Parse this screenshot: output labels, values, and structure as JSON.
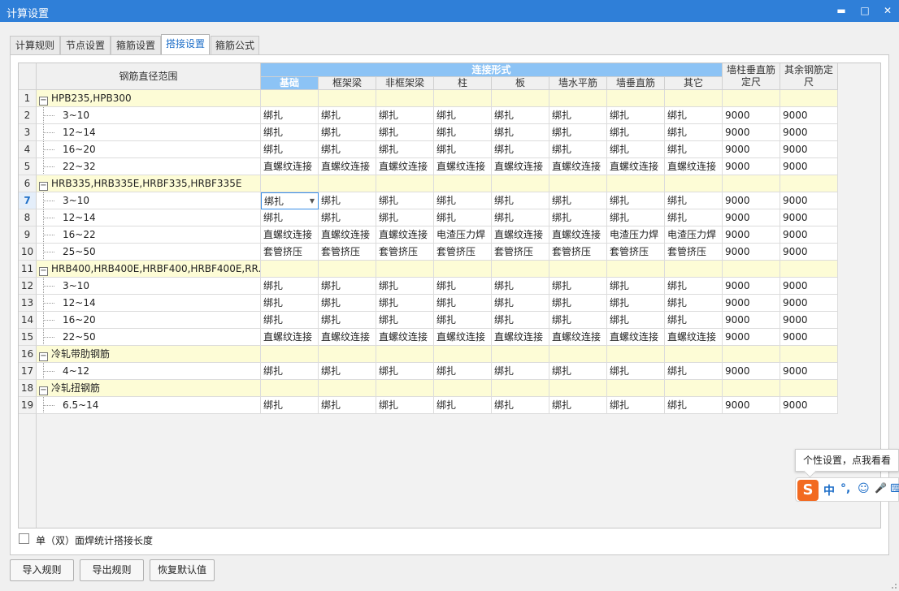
{
  "window": {
    "title": "计算设置",
    "minimize": "▬",
    "maximize": "□",
    "close": "✕"
  },
  "tabs": [
    {
      "label": "计算规则"
    },
    {
      "label": "节点设置"
    },
    {
      "label": "箍筋设置"
    },
    {
      "label": "搭接设置",
      "active": true
    },
    {
      "label": "箍筋公式"
    }
  ],
  "table": {
    "headers": {
      "range": "钢筋直径范围",
      "connect_group": "连接形式",
      "columns": [
        "基础",
        "框架梁",
        "非框架梁",
        "柱",
        "板",
        "墙水平筋",
        "墙垂直筋",
        "其它"
      ],
      "wall_col_len": "墙柱垂直筋定尺",
      "other_len": "其余钢筋定尺"
    },
    "rows": [
      {
        "n": "1",
        "group": true,
        "label": "HPB235,HPB300"
      },
      {
        "n": "2",
        "label": "3~10",
        "c": [
          "绑扎",
          "绑扎",
          "绑扎",
          "绑扎",
          "绑扎",
          "绑扎",
          "绑扎",
          "绑扎"
        ],
        "l1": "9000",
        "l2": "9000"
      },
      {
        "n": "3",
        "label": "12~14",
        "c": [
          "绑扎",
          "绑扎",
          "绑扎",
          "绑扎",
          "绑扎",
          "绑扎",
          "绑扎",
          "绑扎"
        ],
        "l1": "9000",
        "l2": "9000"
      },
      {
        "n": "4",
        "label": "16~20",
        "c": [
          "绑扎",
          "绑扎",
          "绑扎",
          "绑扎",
          "绑扎",
          "绑扎",
          "绑扎",
          "绑扎"
        ],
        "l1": "9000",
        "l2": "9000"
      },
      {
        "n": "5",
        "label": "22~32",
        "c": [
          "直螺纹连接",
          "直螺纹连接",
          "直螺纹连接",
          "直螺纹连接",
          "直螺纹连接",
          "直螺纹连接",
          "直螺纹连接",
          "直螺纹连接"
        ],
        "l1": "9000",
        "l2": "9000"
      },
      {
        "n": "6",
        "group": true,
        "label": "HRB335,HRB335E,HRBF335,HRBF335E"
      },
      {
        "n": "7",
        "label": "3~10",
        "selected": true,
        "c": [
          "绑扎",
          "绑扎",
          "绑扎",
          "绑扎",
          "绑扎",
          "绑扎",
          "绑扎",
          "绑扎"
        ],
        "l1": "9000",
        "l2": "9000"
      },
      {
        "n": "8",
        "label": "12~14",
        "c": [
          "绑扎",
          "绑扎",
          "绑扎",
          "绑扎",
          "绑扎",
          "绑扎",
          "绑扎",
          "绑扎"
        ],
        "l1": "9000",
        "l2": "9000"
      },
      {
        "n": "9",
        "label": "16~22",
        "c": [
          "直螺纹连接",
          "直螺纹连接",
          "直螺纹连接",
          "电渣压力焊",
          "直螺纹连接",
          "直螺纹连接",
          "电渣压力焊",
          "电渣压力焊"
        ],
        "l1": "9000",
        "l2": "9000"
      },
      {
        "n": "10",
        "label": "25~50",
        "c": [
          "套管挤压",
          "套管挤压",
          "套管挤压",
          "套管挤压",
          "套管挤压",
          "套管挤压",
          "套管挤压",
          "套管挤压"
        ],
        "l1": "9000",
        "l2": "9000"
      },
      {
        "n": "11",
        "group": true,
        "label": "HRB400,HRB400E,HRBF400,HRBF400E,RR..."
      },
      {
        "n": "12",
        "label": "3~10",
        "c": [
          "绑扎",
          "绑扎",
          "绑扎",
          "绑扎",
          "绑扎",
          "绑扎",
          "绑扎",
          "绑扎"
        ],
        "l1": "9000",
        "l2": "9000"
      },
      {
        "n": "13",
        "label": "12~14",
        "c": [
          "绑扎",
          "绑扎",
          "绑扎",
          "绑扎",
          "绑扎",
          "绑扎",
          "绑扎",
          "绑扎"
        ],
        "l1": "9000",
        "l2": "9000"
      },
      {
        "n": "14",
        "label": "16~20",
        "c": [
          "绑扎",
          "绑扎",
          "绑扎",
          "绑扎",
          "绑扎",
          "绑扎",
          "绑扎",
          "绑扎"
        ],
        "l1": "9000",
        "l2": "9000"
      },
      {
        "n": "15",
        "label": "22~50",
        "c": [
          "直螺纹连接",
          "直螺纹连接",
          "直螺纹连接",
          "直螺纹连接",
          "直螺纹连接",
          "直螺纹连接",
          "直螺纹连接",
          "直螺纹连接"
        ],
        "l1": "9000",
        "l2": "9000"
      },
      {
        "n": "16",
        "group": true,
        "label": "冷轧带肋钢筋"
      },
      {
        "n": "17",
        "label": "4~12",
        "c": [
          "绑扎",
          "绑扎",
          "绑扎",
          "绑扎",
          "绑扎",
          "绑扎",
          "绑扎",
          "绑扎"
        ],
        "l1": "9000",
        "l2": "9000"
      },
      {
        "n": "18",
        "group": true,
        "label": "冷轧扭钢筋"
      },
      {
        "n": "19",
        "label": "6.5~14",
        "c": [
          "绑扎",
          "绑扎",
          "绑扎",
          "绑扎",
          "绑扎",
          "绑扎",
          "绑扎",
          "绑扎"
        ],
        "l1": "9000",
        "l2": "9000"
      }
    ]
  },
  "checkbox": {
    "label": "单（双）面焊统计搭接长度",
    "checked": false
  },
  "buttons": {
    "import": "导入规则",
    "export": "导出规则",
    "reset": "恢复默认值"
  },
  "ime": {
    "tooltip": "个性设置，点我看看",
    "logo": "S",
    "lang": "中",
    "punct": "°,",
    "emoji": "☺",
    "mic": "🎤",
    "kbd": "⌨"
  },
  "colors": {
    "titlebar": "#2f7fd8",
    "header_active": "#8cc3f5",
    "group_row": "#fdfcd6",
    "selection": "#3a8ee6"
  }
}
